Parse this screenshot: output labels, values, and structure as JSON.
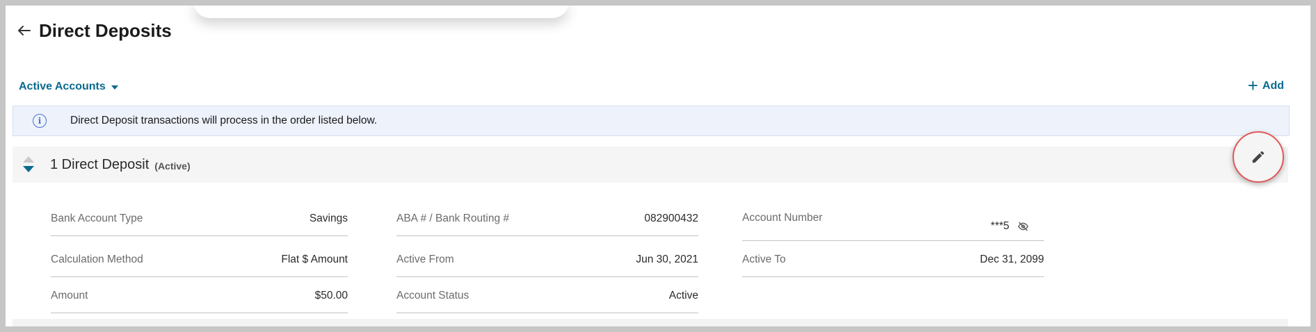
{
  "page": {
    "title": "Direct Deposits"
  },
  "filter": {
    "label": "Active Accounts"
  },
  "actions": {
    "add_label": "Add"
  },
  "banner": {
    "text": "Direct Deposit transactions will process in the order listed below."
  },
  "deposit": {
    "title": "1 Direct Deposit",
    "status": "(Active)",
    "fields": {
      "bank_account_type": {
        "label": "Bank Account Type",
        "value": "Savings"
      },
      "routing": {
        "label": "ABA # / Bank Routing #",
        "value": "082900432"
      },
      "account_number": {
        "label": "Account Number",
        "value": "***5"
      },
      "calculation_method": {
        "label": "Calculation Method",
        "value": "Flat $ Amount"
      },
      "active_from": {
        "label": "Active From",
        "value": "Jun 30, 2021"
      },
      "active_to": {
        "label": "Active To",
        "value": "Dec 31, 2099"
      },
      "amount": {
        "label": "Amount",
        "value": "$50.00"
      },
      "account_status": {
        "label": "Account Status",
        "value": "Active"
      }
    }
  },
  "icons": {
    "back": "arrow-left-icon",
    "caret": "caret-down-icon",
    "add": "plus-icon",
    "info": "info-icon",
    "reorder": "reorder-arrows-icon",
    "edit": "pencil-icon",
    "visibility": "eye-off-icon"
  },
  "colors": {
    "accent": "#0a6a8f",
    "info": "#4a6fd0",
    "highlight_ring": "#e05a5a"
  }
}
